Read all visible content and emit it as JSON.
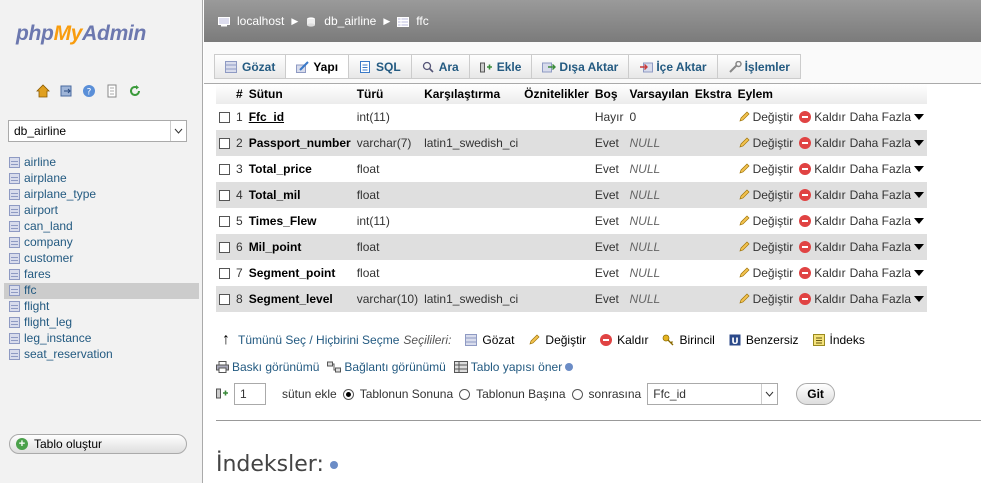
{
  "logo": {
    "php": "php",
    "my": "My",
    "admin": "Admin"
  },
  "nav_icons": [
    "home-icon",
    "exit-icon",
    "help-icon",
    "docs-icon",
    "reload-icon"
  ],
  "database_select": {
    "value": "db_airline"
  },
  "tables": [
    "airline",
    "airplane",
    "airplane_type",
    "airport",
    "can_land",
    "company",
    "customer",
    "fares",
    "ffc",
    "flight",
    "flight_leg",
    "leg_instance",
    "seat_reservation"
  ],
  "active_table": "ffc",
  "create_table_label": "Tablo oluştur",
  "breadcrumb": {
    "server": "localhost",
    "database": "db_airline",
    "table": "ffc"
  },
  "tabs": [
    {
      "label": "Gözat",
      "icon": "browse-icon",
      "active": false
    },
    {
      "label": "Yapı",
      "icon": "structure-icon",
      "active": true
    },
    {
      "label": "SQL",
      "icon": "sql-icon",
      "active": false
    },
    {
      "label": "Ara",
      "icon": "search-icon",
      "active": false
    },
    {
      "label": "Ekle",
      "icon": "insert-icon",
      "active": false
    },
    {
      "label": "Dışa Aktar",
      "icon": "export-icon",
      "active": false
    },
    {
      "label": "İçe Aktar",
      "icon": "import-icon",
      "active": false
    },
    {
      "label": "İşlemler",
      "icon": "operations-icon",
      "active": false
    }
  ],
  "structure": {
    "headers": {
      "num": "#",
      "column": "Sütun",
      "type": "Türü",
      "collation": "Karşılaştırma",
      "attributes": "Öznitelikler",
      "null": "Boş",
      "default": "Varsayılan",
      "extra": "Ekstra",
      "action": "Eylem"
    },
    "rows": [
      {
        "num": "1",
        "name": "Ffc_id",
        "primary": true,
        "type": "int(11)",
        "collation": "",
        "null": "Hayır",
        "default": "0"
      },
      {
        "num": "2",
        "name": "Passport_number",
        "primary": false,
        "type": "varchar(7)",
        "collation": "latin1_swedish_ci",
        "null": "Evet",
        "default": "NULL"
      },
      {
        "num": "3",
        "name": "Total_price",
        "primary": false,
        "type": "float",
        "collation": "",
        "null": "Evet",
        "default": "NULL"
      },
      {
        "num": "4",
        "name": "Total_mil",
        "primary": false,
        "type": "float",
        "collation": "",
        "null": "Evet",
        "default": "NULL"
      },
      {
        "num": "5",
        "name": "Times_Flew",
        "primary": false,
        "type": "int(11)",
        "collation": "",
        "null": "Evet",
        "default": "NULL"
      },
      {
        "num": "6",
        "name": "Mil_point",
        "primary": false,
        "type": "float",
        "collation": "",
        "null": "Evet",
        "default": "NULL"
      },
      {
        "num": "7",
        "name": "Segment_point",
        "primary": false,
        "type": "float",
        "collation": "",
        "null": "Evet",
        "default": "NULL"
      },
      {
        "num": "8",
        "name": "Segment_level",
        "primary": false,
        "type": "varchar(10)",
        "collation": "latin1_swedish_ci",
        "null": "Evet",
        "default": "NULL"
      }
    ],
    "actions": {
      "change": "Değiştir",
      "drop": "Kaldır",
      "more": "Daha Fazla"
    }
  },
  "bulk": {
    "select_all": "Tümünü Seç / Hiçbirini Seçme",
    "selected": "Seçilileri:",
    "browse": "Gözat",
    "change": "Değiştir",
    "drop": "Kaldır",
    "primary": "Birincil",
    "unique": "Benzersiz",
    "index": "İndeks"
  },
  "links": {
    "print": "Baskı görünümü",
    "relation": "Bağlantı görünümü",
    "propose": "Tablo yapısı öner"
  },
  "add_column": {
    "count": "1",
    "label": "sütun ekle",
    "at_end": "Tablonun Sonuna",
    "at_start": "Tablonun Başına",
    "after": "sonrasına",
    "after_value": "Ffc_id",
    "go": "Git"
  },
  "indexes_title": "İndeksler:"
}
